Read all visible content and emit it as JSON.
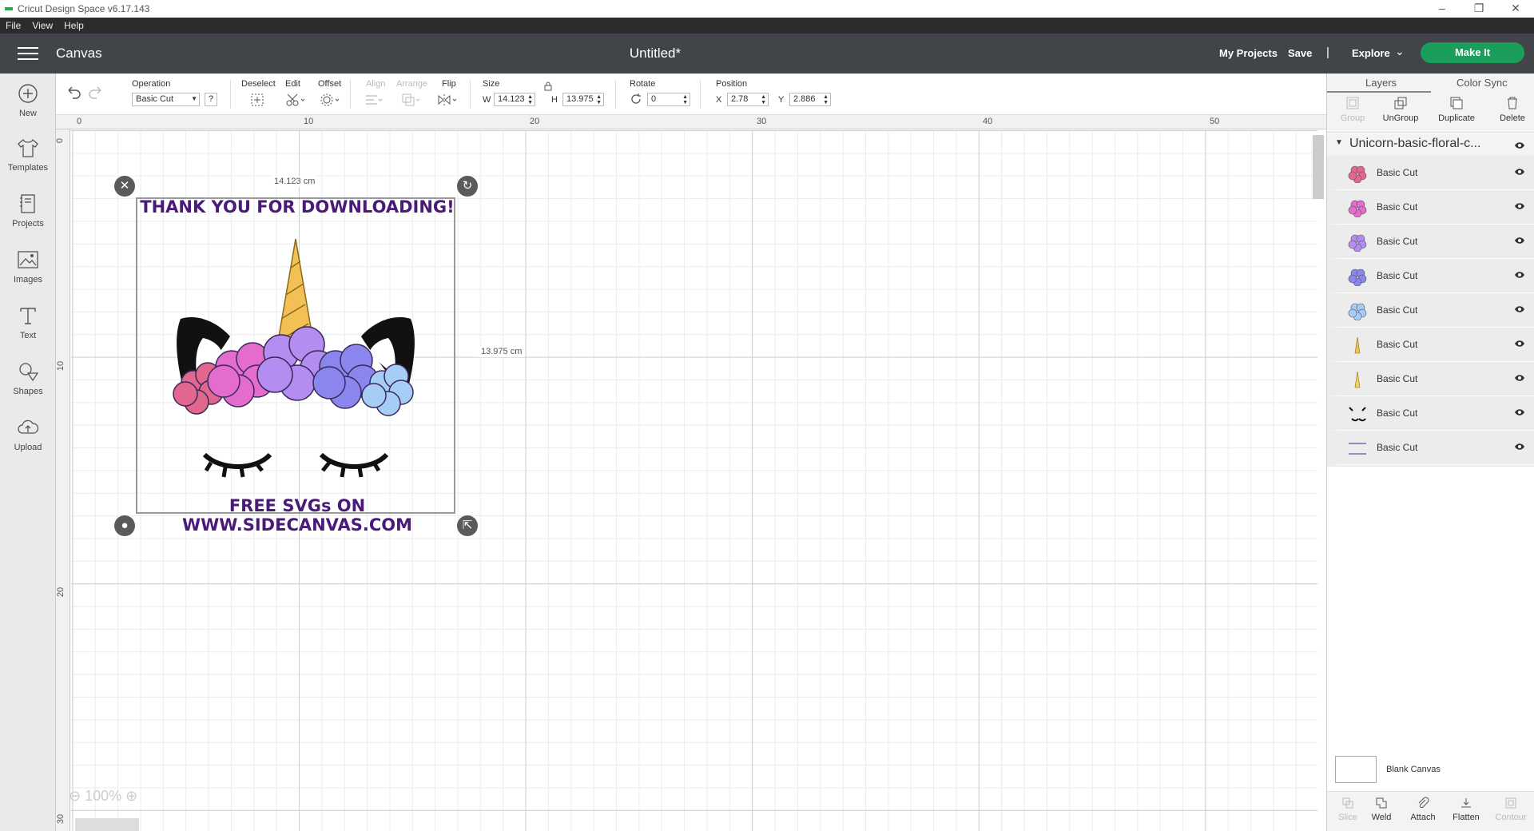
{
  "window": {
    "title": "Cricut Design Space  v6.17.143"
  },
  "menu": [
    "File",
    "View",
    "Help"
  ],
  "header": {
    "section": "Canvas",
    "doc_title": "Untitled*",
    "my_projects": "My Projects",
    "save": "Save",
    "separator": "|",
    "explore": "Explore",
    "make_it": "Make It"
  },
  "sidebar": {
    "items": [
      {
        "label": "New",
        "icon": "plus-circle-icon"
      },
      {
        "label": "Templates",
        "icon": "shirt-icon"
      },
      {
        "label": "Projects",
        "icon": "notebook-icon"
      },
      {
        "label": "Images",
        "icon": "image-icon"
      },
      {
        "label": "Text",
        "icon": "text-icon"
      },
      {
        "label": "Shapes",
        "icon": "shapes-icon"
      },
      {
        "label": "Upload",
        "icon": "cloud-upload-icon"
      }
    ]
  },
  "toolbar": {
    "operation_label": "Operation",
    "operation_value": "Basic Cut",
    "help": "?",
    "deselect": "Deselect",
    "edit": "Edit",
    "offset": "Offset",
    "align": "Align",
    "arrange": "Arrange",
    "flip": "Flip",
    "size_label": "Size",
    "w_label": "W",
    "w_value": "14.123",
    "h_label": "H",
    "h_value": "13.975",
    "rotate_label": "Rotate",
    "rotate_value": "0",
    "position_label": "Position",
    "x_label": "X",
    "x_value": "2.78",
    "y_label": "Y",
    "y_value": "2.886"
  },
  "canvas": {
    "ruler_top": [
      "0",
      "10",
      "20",
      "30",
      "40",
      "50"
    ],
    "ruler_left": [
      "0",
      "10",
      "20",
      "30"
    ],
    "width_label": "14.123 cm",
    "height_label": "13.975 cm",
    "text_top": "THANK YOU FOR DOWNLOADING!",
    "text_bottom": "FREE SVGs ON WWW.SIDECANVAS.COM",
    "zoom": "100%"
  },
  "right_panel": {
    "tabs": [
      "Layers",
      "Color Sync"
    ],
    "actions": [
      "Group",
      "UnGroup",
      "Duplicate",
      "Delete"
    ],
    "group_name": "Unicorn-basic-floral-c...",
    "layers": [
      {
        "name": "Basic Cut",
        "color": "#e2678e"
      },
      {
        "name": "Basic Cut",
        "color": "#e36ccc"
      },
      {
        "name": "Basic Cut",
        "color": "#b38df0"
      },
      {
        "name": "Basic Cut",
        "color": "#8a86ee"
      },
      {
        "name": "Basic Cut",
        "color": "#a6cdf6"
      },
      {
        "name": "Basic Cut",
        "color": "#f2c055"
      },
      {
        "name": "Basic Cut",
        "color": "#f0d65c"
      },
      {
        "name": "Basic Cut",
        "color": "#111111"
      },
      {
        "name": "Basic Cut",
        "color": "#3f2a86"
      }
    ],
    "blank_canvas": "Blank Canvas",
    "bottom_actions": [
      "Slice",
      "Weld",
      "Attach",
      "Flatten",
      "Contour"
    ]
  }
}
